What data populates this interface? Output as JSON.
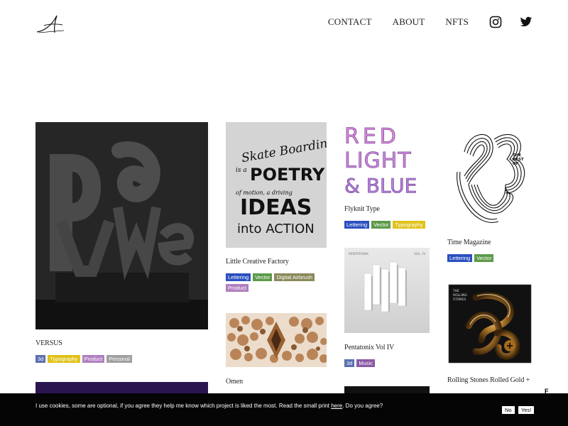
{
  "header": {
    "logo_icon": "signature-a-logo",
    "nav": {
      "contact": "CONTACT",
      "about": "ABOUT",
      "nfts": "NFTS"
    },
    "social": [
      "instagram-icon",
      "twitter-icon"
    ]
  },
  "tag_colors": {
    "3d": "#5a6fb0",
    "Typography": "#e0c21a",
    "Product": "#b07fc0",
    "Personal": "#a0a0a0",
    "Lettering": "#2a4fbf",
    "Vector": "#5d9a4a",
    "Digital Airbrush": "#8a8a5a",
    "Music": "#8a5aa5"
  },
  "projects": {
    "versus": {
      "title": "VERSUS",
      "tags": [
        "3d",
        "Typography",
        "Product",
        "Personal"
      ]
    },
    "little_creative_factory": {
      "title": "Little Creative Factory",
      "tags": [
        "Lettering",
        "Vector",
        "Digital Airbrush",
        "Product"
      ],
      "art_text": [
        "Skate Boarding",
        "is a",
        "POETRY",
        "of motion, a driving",
        "IDEAS",
        "into ACTION"
      ]
    },
    "omen": {
      "title": "Omen"
    },
    "flyknit_type": {
      "title": "Flyknit Type",
      "tags": [
        "Lettering",
        "Vector",
        "Typography"
      ],
      "art_text": [
        "RED",
        "LIGHT",
        "& BLUE"
      ]
    },
    "pentatonix": {
      "title": "Pentatonix Vol IV",
      "tags": [
        "3d",
        "Music"
      ],
      "art_text": [
        "PENTATONIX",
        "VOL. IV"
      ]
    },
    "time_magazine": {
      "title": "Time Magazine",
      "tags": [
        "Lettering",
        "Vector"
      ],
      "art_text": [
        "THE",
        "BEST",
        "OF"
      ]
    },
    "rolling_stones": {
      "title": "Rolling Stones Rolled Gold +",
      "art_text": [
        "THE",
        "ROLLING",
        "STONES"
      ]
    }
  },
  "cookie": {
    "text_before": "I use cookies, some are optional, if you agree they help me know which project is liked the most. Read the small print ",
    "link": "here",
    "text_after": ". Do you agree?",
    "no_label": "No",
    "yes_label": "Yes!"
  },
  "side_mark": "F"
}
